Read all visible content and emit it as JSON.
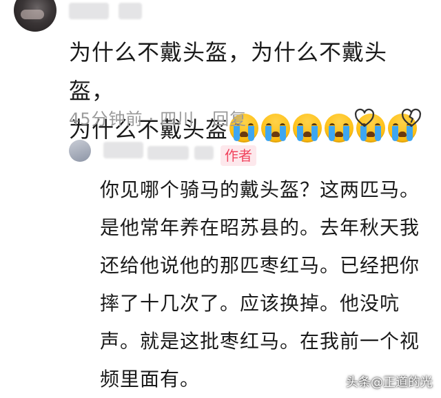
{
  "comment": {
    "line1": "为什么不戴头盔，为什么不戴头盔，",
    "line2": "为什么不戴头盔",
    "emoji_icon": "crying-face-icon",
    "emoji_count": 6,
    "time": "45分钟前",
    "separator": "·",
    "location": "四川",
    "reply_label": "回复"
  },
  "reply": {
    "badge": "作者",
    "badge_color": "#f0445e",
    "text": "你见哪个骑马的戴头盔？这两匹马。是他常年养在昭苏县的。去年秋天我还给他说他的那匹枣红马。已经把你摔了十几次了。应该换掉。他没吭声。就是这批枣红马。在我前一个视频里面有。"
  },
  "watermark": "头条@正道的光"
}
